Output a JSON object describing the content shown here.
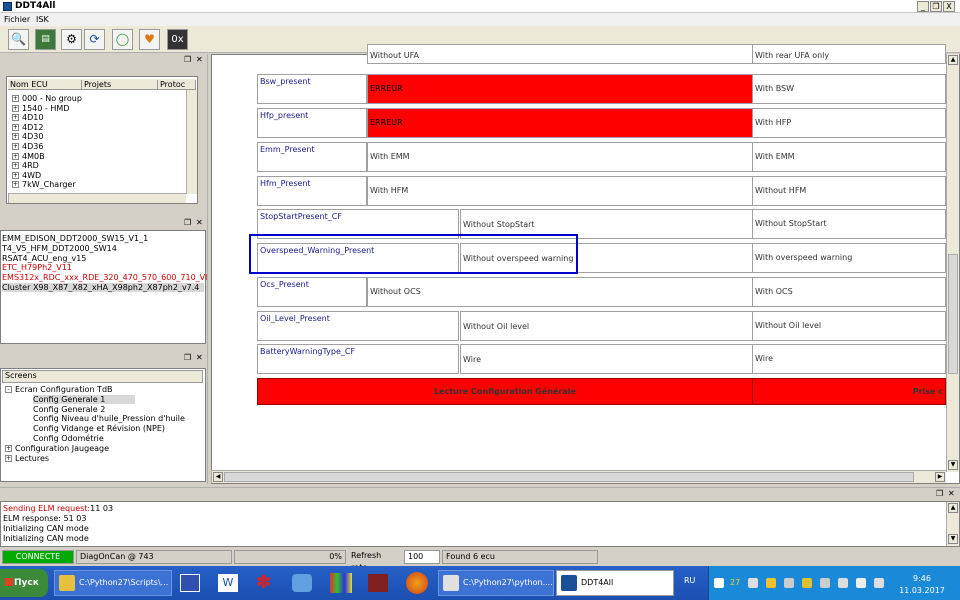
{
  "window": {
    "title": "DDT4All",
    "controls": [
      "_",
      "❐",
      "X"
    ]
  },
  "menu": {
    "items": [
      "Fichier",
      "ISK"
    ]
  },
  "toolbar": {
    "buttons": [
      "scan-icon",
      "sniffer-icon",
      "settings-icon",
      "refresh-icon",
      "connect-icon",
      "heart-icon",
      "hex-icon"
    ],
    "hex_label": "0x"
  },
  "ecu_panel": {
    "columns": [
      "Nom ECU",
      "Projets",
      "Protoc"
    ],
    "groups": [
      "000 - No group",
      "1540 - HMD",
      "4D10",
      "4D12",
      "4D30",
      "4D36",
      "4M0B",
      "4RD",
      "4WD",
      "7kW_Charger"
    ]
  },
  "files_panel": {
    "items": [
      {
        "label": "EMM_EDISON_DDT2000_SW15_V1_1",
        "color": "#000000"
      },
      {
        "label": "T4_V5_HFM_DDT2000_SW14",
        "color": "#000000"
      },
      {
        "label": "RSAT4_ACU_eng_v15",
        "color": "#000000"
      },
      {
        "label": "ETC_H79Ph2_V11",
        "color": "#cc0000"
      },
      {
        "label": "EMS312x_RDC_xxx_RDE_320_470_570_600_710_V01",
        "color": "#cc0000"
      },
      {
        "label": "Cluster X98_X87_X82_xHA_X98ph2_X87ph2_v7.4",
        "color": "#000000",
        "selected": true
      }
    ]
  },
  "screens_panel": {
    "header": "Screens",
    "root": "Ecran Configuration TdB",
    "children": [
      "Config Generale 1",
      "Config Generale 2",
      "Config Niveau d'huile_Pression d'huile",
      "Config Vidange et Révision (NPE)",
      "Config Odométrie"
    ],
    "others": [
      "Configuration Jaugeage",
      "Lectures"
    ]
  },
  "grid": {
    "top_partial": {
      "left": "Without UFA",
      "right": "With rear UFA only"
    },
    "rows": [
      {
        "name": "Bsw_present",
        "value": "ERREUR",
        "right": "With BSW",
        "error": true
      },
      {
        "name": "Hfp_present",
        "value": "ERREUR",
        "right": "With HFP",
        "error": true
      },
      {
        "name": "Emm_Present",
        "value": "With EMM",
        "right": "With EMM"
      },
      {
        "name": "Hfm_Present",
        "value": "With HFM",
        "right": "Without HFM"
      },
      {
        "name": "StopStartPresent_CF",
        "value": "Without StopStart",
        "right": "Without StopStart"
      },
      {
        "name": "Overspeed_Warning_Present",
        "value": "Without overspeed warning",
        "right": "With overspeed warning"
      },
      {
        "name": "Ocs_Present",
        "value": "Without OCS",
        "right": "With OCS"
      },
      {
        "name": "Oil_Level_Present",
        "value": "Without Oil  level",
        "right": "Without Oil  level"
      },
      {
        "name": "BatteryWarningType_CF",
        "value": "Wire",
        "right": "Wire"
      }
    ],
    "buttons": {
      "read": "Lecture Configuration Générale",
      "take": "Prise c"
    },
    "highlight_color": "#0000cc"
  },
  "log": {
    "lines": [
      {
        "text": "Sending ELM request:",
        "extra": "11 03",
        "color": "#cc0000"
      },
      {
        "text": "ELM response: 51 03",
        "color": "#000000"
      },
      {
        "text": "Initializing CAN mode",
        "color": "#000000"
      },
      {
        "text": "Initializing CAN mode",
        "color": "#000000"
      }
    ]
  },
  "status": {
    "connected": "CONNECTE",
    "connected_color": "#00aa00",
    "protocol": "DiagOnCan @ 743",
    "progress": "0%",
    "refresh_label": "Refresh rate:",
    "refresh_value": "100",
    "found": "Found 6 ecu"
  },
  "taskbar": {
    "start": "Пуск",
    "tasks": [
      "C:\\Python27\\Scripts\\...",
      "C:\\Python27\\python....",
      "DDT4All"
    ],
    "lang": "RU",
    "time": "9:46",
    "date": "11.03.2017",
    "temp": "27"
  }
}
